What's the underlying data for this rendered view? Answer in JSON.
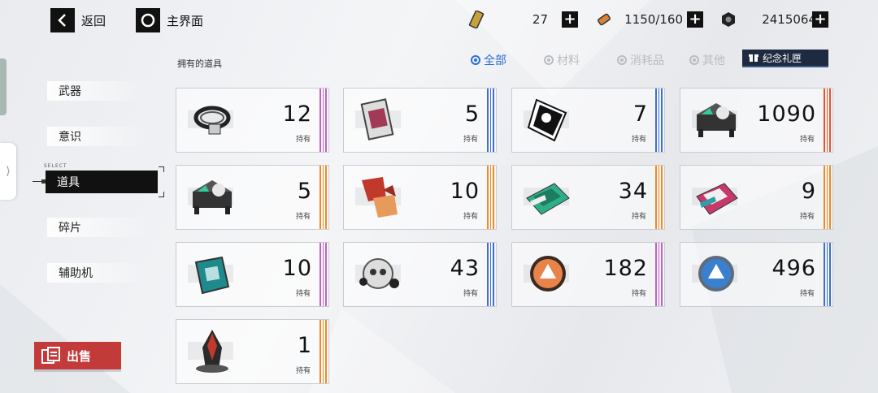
{
  "topbar": {
    "back_label": "返回",
    "home_label": "主界面",
    "resources": [
      {
        "icon": "ticket-icon",
        "value": "27"
      },
      {
        "icon": "battery-icon",
        "value": "1150/160"
      },
      {
        "icon": "coin-icon",
        "value": "2415064"
      }
    ]
  },
  "section_title": "拥有的道具",
  "sidebar": {
    "select_caption": "SELECT",
    "items": [
      {
        "label": "武器"
      },
      {
        "label": "意识"
      },
      {
        "label": "道具"
      },
      {
        "label": "碎片"
      },
      {
        "label": "辅助机"
      }
    ],
    "active_index": 2
  },
  "sell_label": "出售",
  "filters": [
    {
      "label": "全部",
      "active": true
    },
    {
      "label": "材料",
      "active": false
    },
    {
      "label": "消耗品",
      "active": false
    },
    {
      "label": "其他",
      "active": false
    }
  ],
  "gift_label": "纪念礼匣",
  "owned_label": "持有",
  "rarity_colors": {
    "purple": "#c060c8",
    "blue": "#3f6fd0",
    "orange": "#f08a22",
    "red": "#e8522a"
  },
  "items": [
    {
      "icon": "cable-coil-icon",
      "count": "12",
      "rarity": "purple"
    },
    {
      "icon": "card-icon",
      "count": "5",
      "rarity": "blue"
    },
    {
      "icon": "black-emblem-icon",
      "count": "7",
      "rarity": "blue"
    },
    {
      "icon": "chip-case-icon",
      "count": "1090",
      "rarity": "red"
    },
    {
      "icon": "chip-case-icon",
      "count": "5",
      "rarity": "orange"
    },
    {
      "icon": "crystal-shard-icon",
      "count": "10",
      "rarity": "orange"
    },
    {
      "icon": "green-circuit-board-icon",
      "count": "34",
      "rarity": "orange"
    },
    {
      "icon": "pink-circuit-board-icon",
      "count": "9",
      "rarity": "orange"
    },
    {
      "icon": "blue-circuit-board-icon",
      "count": "10",
      "rarity": "purple"
    },
    {
      "icon": "skull-core-icon",
      "count": "43",
      "rarity": "blue"
    },
    {
      "icon": "orange-medal-icon",
      "count": "182",
      "rarity": "purple"
    },
    {
      "icon": "blue-medal-icon",
      "count": "496",
      "rarity": "blue"
    },
    {
      "icon": "dark-crystal-icon",
      "count": "1",
      "rarity": "orange"
    }
  ]
}
